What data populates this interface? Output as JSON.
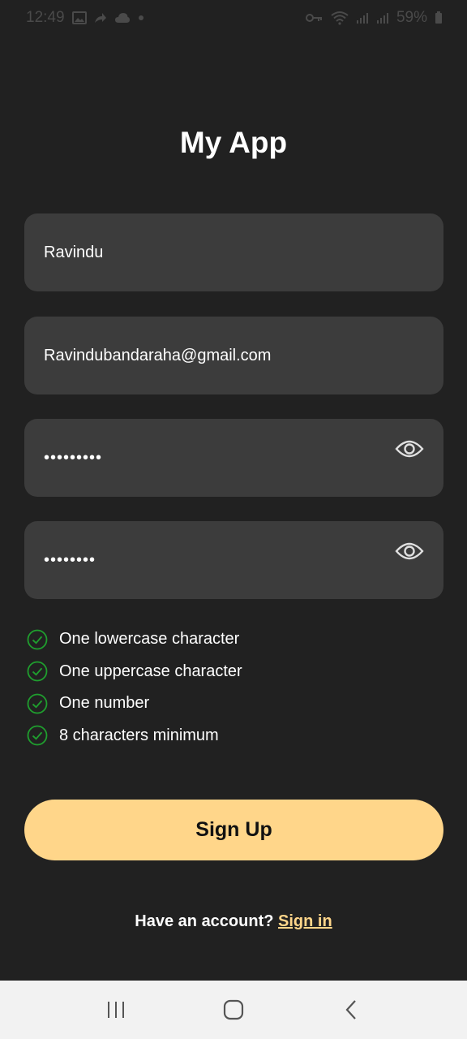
{
  "status_bar": {
    "time": "12:49",
    "battery": "59%",
    "left_icons": [
      "gallery-icon",
      "share-arrow-icon",
      "cloud-icon",
      "dot-icon"
    ],
    "right_icons": [
      "key-icon",
      "wifi-icon",
      "signal-icon",
      "signal-icon",
      "battery-icon"
    ]
  },
  "app": {
    "title": "My App"
  },
  "form": {
    "name_value": "Ravindu",
    "email_value": "Ravindubandaraha@gmail.com",
    "password_value": "•••••••••",
    "confirm_password_value": "••••••••",
    "eye_icon": "eye-icon"
  },
  "requirements": [
    {
      "label": "One lowercase character",
      "met": true
    },
    {
      "label": "One uppercase character",
      "met": true
    },
    {
      "label": "One number",
      "met": true
    },
    {
      "label": "8 characters minimum",
      "met": true
    }
  ],
  "signup_label": "Sign Up",
  "footer": {
    "prompt": "Have an account?",
    "link": "Sign in"
  },
  "nav": {
    "buttons": [
      "recent-apps-icon",
      "home-icon",
      "back-icon"
    ]
  },
  "colors": {
    "background": "#212121",
    "field": "#3c3c3c",
    "accent": "#ffd68a",
    "check": "#1f9e2e",
    "nav_bar": "#f2f2f2"
  }
}
